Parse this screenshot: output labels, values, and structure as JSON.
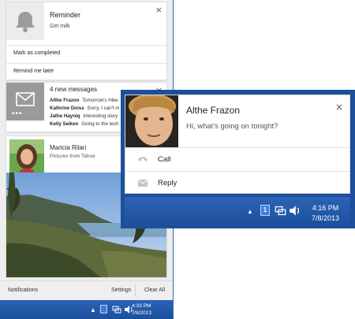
{
  "notification_center": {
    "reminder": {
      "title": "Reminder",
      "text": "Get milk",
      "action_primary": "Mark as completed",
      "action_secondary": "Remind me later",
      "close": "×"
    },
    "messages": {
      "title": "4 new messages",
      "dots": "•••",
      "close": "×",
      "items": [
        {
          "sender": "Althe Frazon",
          "preview": "Tomorrow's Hike"
        },
        {
          "sender": "Kathrine Doiss",
          "preview": "Sorry, I can't m"
        },
        {
          "sender": "Jathe Hayniq",
          "preview": "Interesting story"
        },
        {
          "sender": "Kelly Seiken",
          "preview": "Going to the tech"
        }
      ]
    },
    "photo": {
      "title": "Maricia Rilari",
      "text": "Pictures from Tahoe"
    },
    "footer": {
      "notifications": "Notifications",
      "settings": "Settings",
      "clear_all": "Clear All"
    },
    "taskbar": {
      "time": "4:33 PM",
      "date": "7/8/2013"
    }
  },
  "toast": {
    "name": "Althe Frazon",
    "message": "Hi, what's going on tonight?",
    "close": "×",
    "actions": [
      {
        "label": "Call",
        "icon": "phone-icon"
      },
      {
        "label": "Reply",
        "icon": "mail-icon"
      }
    ],
    "taskbar": {
      "time": "4:16 PM",
      "date": "7/8/2013",
      "badge": "1"
    }
  },
  "colors": {
    "taskbar": "#1f56a6",
    "card_background": "#ffffff",
    "panel_background": "#eeeeee"
  }
}
